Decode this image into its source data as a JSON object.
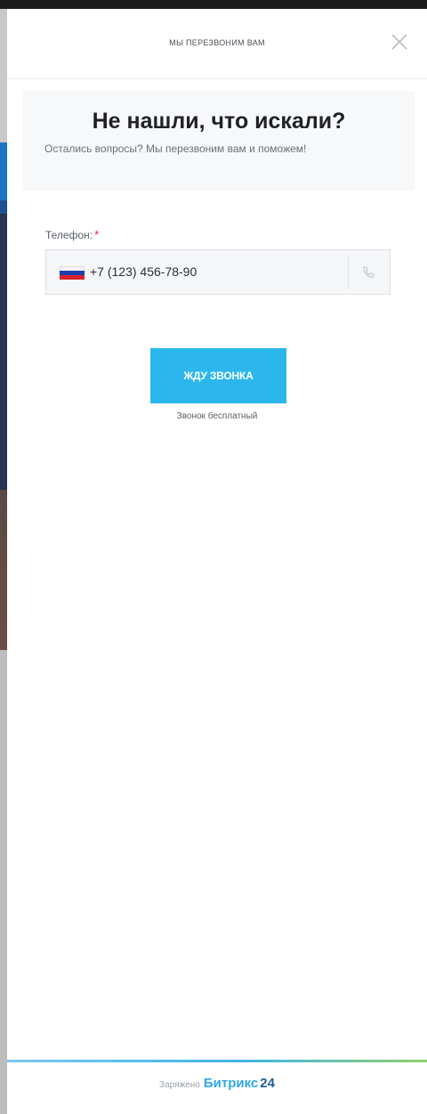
{
  "header": {
    "title": "МЫ ПЕРЕЗВОНИМ ВАМ",
    "close_icon": "close-icon"
  },
  "hero": {
    "title": "Не нашли, что искали?",
    "subtitle": "Остались вопросы? Мы перезвоним вам и поможем!"
  },
  "form": {
    "phone_label": "Телефон:",
    "required_mark": "*",
    "phone_value": "+7 (123) 456-78-90",
    "country_flag": "russia-flag-icon",
    "phone_icon": "phone-icon"
  },
  "submit": {
    "label": "ЖДУ ЗВОНКА",
    "note": "Звонок бесплатный"
  },
  "footer": {
    "powered_label": "Заряжено",
    "brand_name": "Битрикс",
    "brand_number": "24"
  },
  "colors": {
    "accent": "#2cb7ec",
    "required": "#e0212d",
    "brand_blue": "#2fa8e6",
    "brand_dark": "#1d5d8f"
  }
}
